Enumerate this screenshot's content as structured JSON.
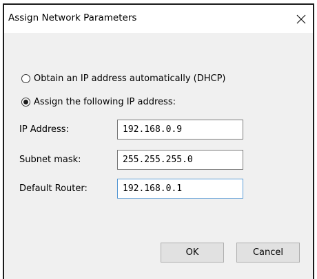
{
  "window": {
    "title": "Assign Network Parameters",
    "close_icon": "close-icon"
  },
  "options": {
    "dhcp_label": "Obtain an IP address automatically (DHCP)",
    "dhcp_selected": false,
    "static_label": "Assign the following IP address:",
    "static_selected": true
  },
  "fields": {
    "ip_label": "IP Address:",
    "ip_value": "192.168.0.9",
    "subnet_label": "Subnet mask:",
    "subnet_value": "255.255.255.0",
    "router_label": "Default Router:",
    "router_value": "192.168.0.1"
  },
  "buttons": {
    "ok_label": "OK",
    "cancel_label": "Cancel"
  },
  "colors": {
    "dialog_background": "#f0f0f0",
    "titlebar_background": "#ffffff",
    "focus_border": "#5a9bd5"
  }
}
